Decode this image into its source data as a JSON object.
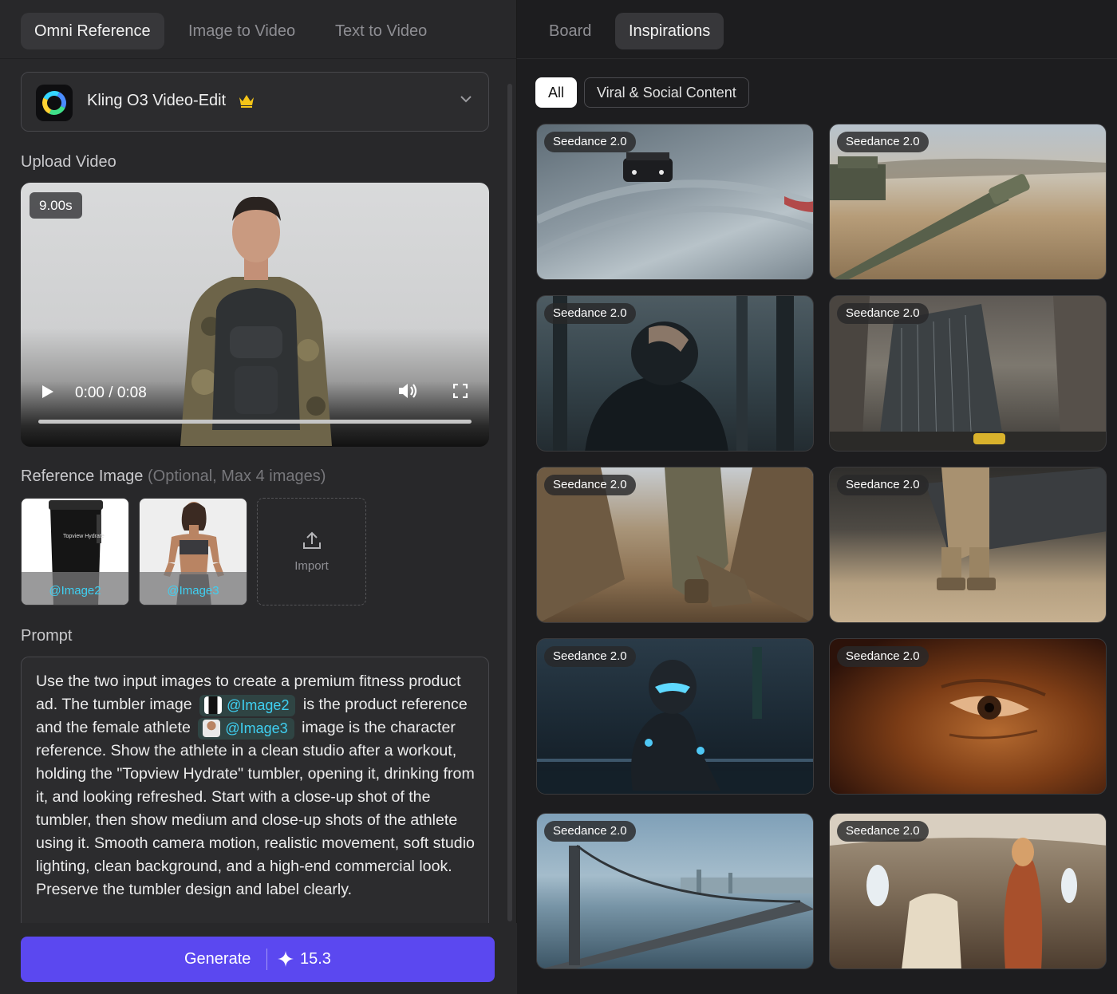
{
  "left_tabs": [
    "Omni Reference",
    "Image to Video",
    "Text to Video"
  ],
  "active_left_tab": "Omni Reference",
  "model": {
    "name": "Kling O3 Video-Edit",
    "premium_icon": "crown-icon"
  },
  "upload_video": {
    "label": "Upload Video",
    "duration": "9.00s",
    "time": "0:00 / 0:08"
  },
  "reference": {
    "label": "Reference Image",
    "hint": "(Optional, Max 4 images)",
    "images": [
      {
        "tag": "@Image2",
        "product_text": "Topview Hydrate"
      },
      {
        "tag": "@Image3"
      }
    ],
    "import_label": "Import"
  },
  "prompt": {
    "label": "Prompt",
    "part1": "Use the two input images to create a premium fitness product ad. The tumbler image",
    "chip1": "@Image2",
    "part2": "is the product reference and the female athlete",
    "chip2": "@Image3",
    "part3": "image is the character reference. Show the athlete in a clean studio after a workout, holding the \"Topview Hydrate\" tumbler, opening it, drinking from it, and looking refreshed. Start with a close-up shot of the tumbler, then show medium and close-up shots of the athlete using it. Smooth camera motion, realistic movement, soft studio lighting, clean background, and a high-end commercial look. Preserve the tumbler design and label clearly."
  },
  "generate": {
    "label": "Generate",
    "credits": "15.3"
  },
  "right_tabs": [
    "Board",
    "Inspirations"
  ],
  "active_right_tab": "Inspirations",
  "filters": [
    "All",
    "Viral & Social Content"
  ],
  "active_filter": "All",
  "gallery": [
    {
      "badge": "Seedance 2.0"
    },
    {
      "badge": "Seedance 2.0"
    },
    {
      "badge": "Seedance 2.0"
    },
    {
      "badge": "Seedance 2.0"
    },
    {
      "badge": "Seedance 2.0"
    },
    {
      "badge": "Seedance 2.0"
    },
    {
      "badge": "Seedance 2.0"
    },
    {
      "badge": "Seedance 2.0"
    },
    {
      "badge": "Seedance 2.0"
    },
    {
      "badge": "Seedance 2.0"
    }
  ],
  "colors": {
    "accent": "#5b48f0",
    "tag": "#3fd0f2"
  }
}
